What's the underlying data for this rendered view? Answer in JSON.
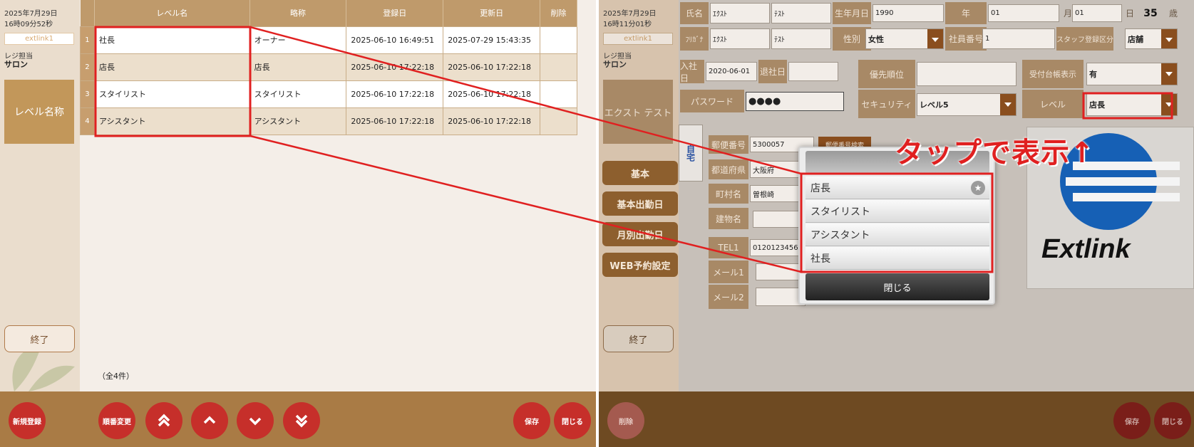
{
  "left": {
    "date": "2025年7月29日",
    "time": "16時09分52秒",
    "link": "extlink1",
    "role_label": "レジ担当",
    "role_value": "サロン",
    "section_title": "レベル名称",
    "end_button": "終了",
    "table": {
      "headers": [
        "",
        "レベル名",
        "略称",
        "登録日",
        "更新日",
        "削除"
      ],
      "rows": [
        {
          "no": "1",
          "name": "社長",
          "abbr": "オーナー",
          "created": "2025-06-10 16:49:51",
          "updated": "2025-07-29 15:43:35"
        },
        {
          "no": "2",
          "name": "店長",
          "abbr": "店長",
          "created": "2025-06-10 17:22:18",
          "updated": "2025-06-10 17:22:18"
        },
        {
          "no": "3",
          "name": "スタイリスト",
          "abbr": "スタイリスト",
          "created": "2025-06-10 17:22:18",
          "updated": "2025-06-10 17:22:18"
        },
        {
          "no": "4",
          "name": "アシスタント",
          "abbr": "アシスタント",
          "created": "2025-06-10 17:22:18",
          "updated": "2025-06-10 17:22:18"
        }
      ]
    },
    "count": "（全4件）",
    "buttons": {
      "new": "新規登録",
      "reorder": "順番変更",
      "save": "保存",
      "close": "閉じる"
    }
  },
  "right": {
    "date": "2025年7月29日",
    "time": "16時11分01秒",
    "link": "extlink1",
    "role_label": "レジ担当",
    "role_value": "サロン",
    "staff_name": "エクスト テスト",
    "form": {
      "name_label": "氏名",
      "last_name": "ｴｸｽﾄ",
      "first_name": "ﾃｽﾄ",
      "birth_label": "生年月日",
      "birth_year": "1990",
      "year_unit": "年",
      "birth_month": "01",
      "month_unit": "月",
      "birth_day": "01",
      "day_unit": "日",
      "age": "35",
      "age_unit": "歳",
      "kana_label": "ﾌﾘｶﾞﾅ",
      "kana_last": "ｴｸｽﾄ",
      "kana_first": "ﾃｽﾄ",
      "gender_label": "性別",
      "gender_value": "女性",
      "emp_no_label": "社員番号",
      "emp_no_value": "1",
      "staff_type_label": "スタッフ登録区分",
      "staff_type_value": "店舗",
      "join_label": "入社日",
      "join_value": "2020-06-01",
      "leave_label": "退社日",
      "priority_label": "優先順位",
      "reception_label": "受付台帳表示",
      "reception_value": "有",
      "password_label": "パスワード",
      "password_value": "●●●●",
      "security_label": "セキュリティ",
      "security_value": "レベル5",
      "level_label": "レベル",
      "level_value": "店長",
      "home_tab": "自宅",
      "postal_label": "郵便番号",
      "postal_value": "5300057",
      "postal_search": "郵便番号検索",
      "pref_label": "都道府県",
      "pref_value": "大阪府",
      "city_label": "町村名",
      "city_value": "曽根崎",
      "building_label": "建物名",
      "tel_label": "TEL1",
      "tel_value": "01201234567",
      "mail1_label": "メール1",
      "mail2_label": "メール2"
    },
    "nav": [
      "基本",
      "基本出勤日",
      "月別出勤日",
      "WEB予約設定"
    ],
    "end_button": "終了",
    "buttons": {
      "delete": "削除",
      "save": "保存",
      "close": "閉じる"
    },
    "popup": {
      "options": [
        "店長",
        "スタイリスト",
        "アシスタント",
        "社長"
      ],
      "close": "閉じる"
    },
    "annotation": "タップで表示↑",
    "logo_text": "Extlink"
  },
  "colors": {
    "annotation_red": "#e02020",
    "button_red": "#c62f2a",
    "header_brown": "#bf9a6b",
    "bar_brown": "#a97b45"
  }
}
